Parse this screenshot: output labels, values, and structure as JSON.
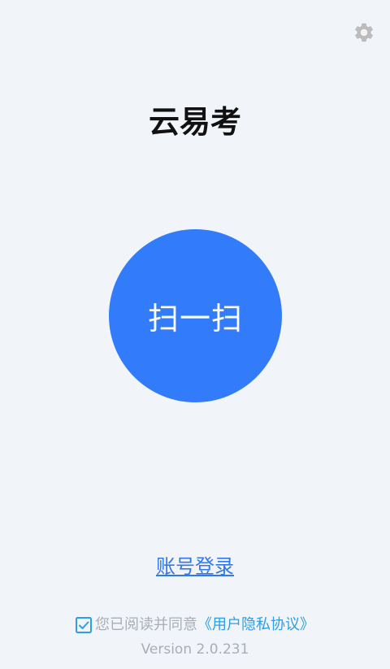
{
  "app": {
    "title": "云易考"
  },
  "settings": {
    "icon": "gear-icon"
  },
  "scan": {
    "label": "扫一扫",
    "color": "#327cfb"
  },
  "login": {
    "label": "账号登录"
  },
  "agreement": {
    "checked": true,
    "text": "您已阅读并同意",
    "link": "《用户隐私协议》"
  },
  "footer": {
    "version": "Version 2.0.231"
  },
  "colors": {
    "background": "#f1f4f9",
    "link": "#2f78f0",
    "muted": "#a9aeb6"
  }
}
